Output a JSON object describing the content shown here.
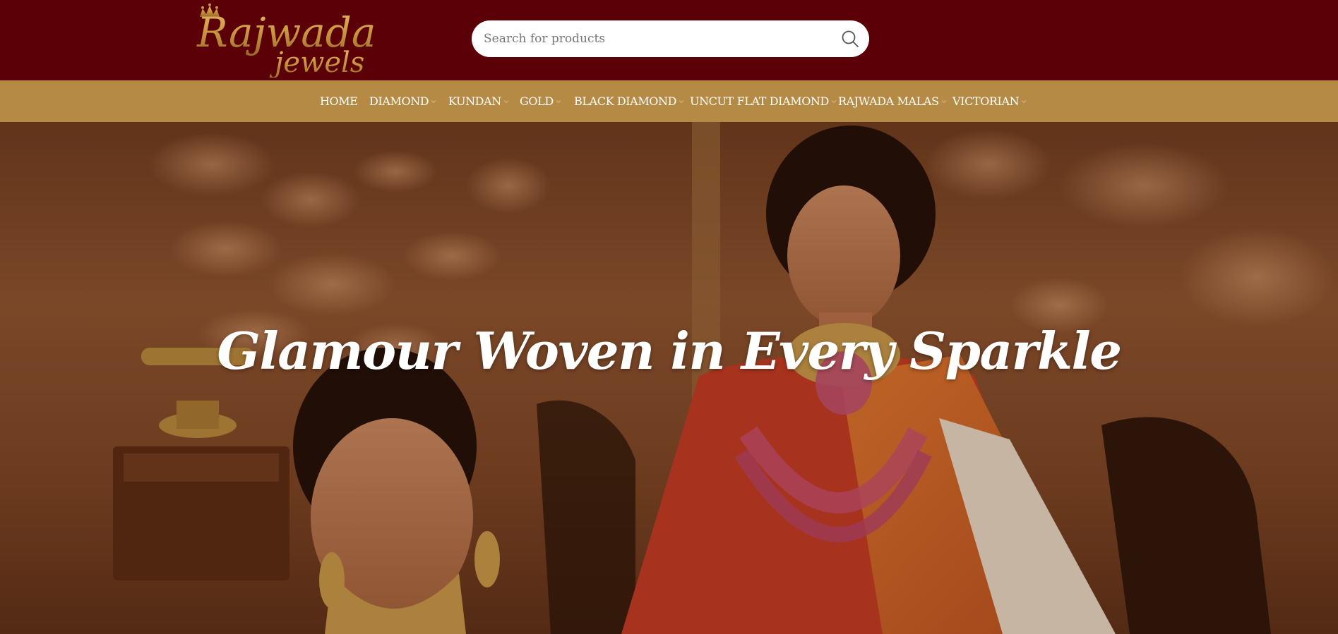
{
  "brand": {
    "logo_line1": "Rajwada",
    "logo_line2": "jewels",
    "colors": {
      "header_bg": "#5b0006",
      "nav_bg": "#b58a44",
      "gold": "#c8973f"
    }
  },
  "search": {
    "placeholder": "Search for products",
    "icon": "search-icon"
  },
  "nav": {
    "items": [
      {
        "label": "HOME",
        "has_dropdown": false
      },
      {
        "label": "DIAMOND",
        "has_dropdown": true
      },
      {
        "label": "KUNDAN",
        "has_dropdown": true
      },
      {
        "label": "GOLD",
        "has_dropdown": true
      },
      {
        "label": "BLACK DIAMOND",
        "has_dropdown": true
      },
      {
        "label": "UNCUT FLAT DIAMOND",
        "has_dropdown": true
      },
      {
        "label": "RAJWADA MALAS",
        "has_dropdown": true
      },
      {
        "label": "VICTORIAN",
        "has_dropdown": true
      }
    ]
  },
  "hero": {
    "title": "Glamour Woven in Every Sparkle"
  }
}
